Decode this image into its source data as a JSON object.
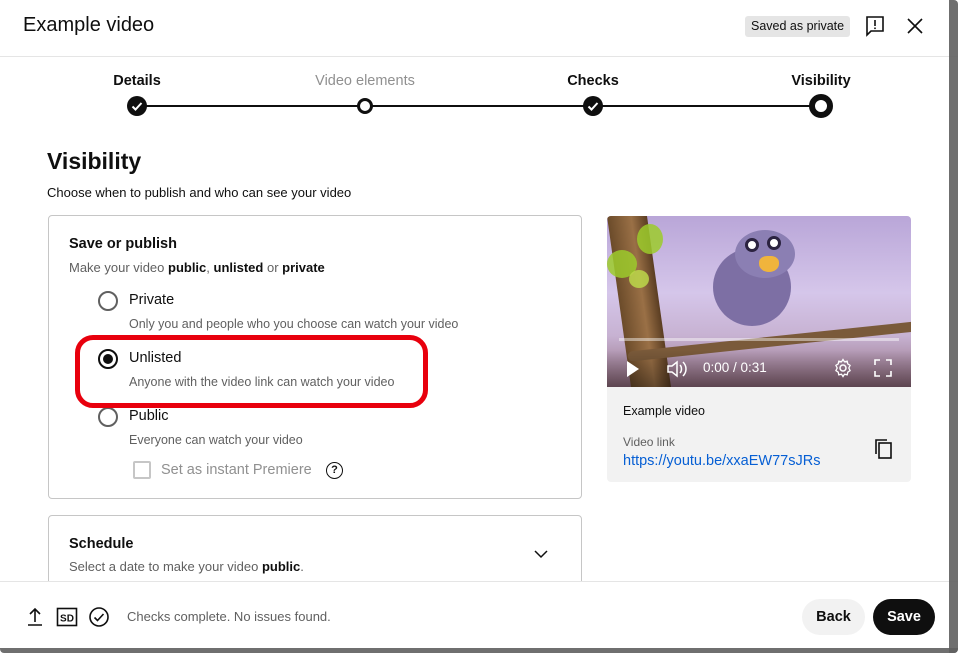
{
  "header": {
    "title": "Example video",
    "badge": "Saved as private"
  },
  "stepper": {
    "steps": [
      {
        "label": "Details",
        "state": "done"
      },
      {
        "label": "Video elements",
        "state": "pending"
      },
      {
        "label": "Checks",
        "state": "done"
      },
      {
        "label": "Visibility",
        "state": "current"
      }
    ]
  },
  "visibility": {
    "heading": "Visibility",
    "subheading": "Choose when to publish and who can see your video",
    "save_publish": {
      "title": "Save or publish",
      "sub_prefix": "Make your video ",
      "sub_public": "public",
      "sub_sep1": ", ",
      "sub_unlisted": "unlisted",
      "sub_or": " or ",
      "sub_private": "private",
      "options": [
        {
          "label": "Private",
          "desc": "Only you and people who you choose can watch your video",
          "selected": false
        },
        {
          "label": "Unlisted",
          "desc": "Anyone with the video link can watch your video",
          "selected": true
        },
        {
          "label": "Public",
          "desc": "Everyone can watch your video",
          "selected": false
        }
      ],
      "premiere_label": "Set as instant Premiere",
      "premiere_help": "?"
    },
    "schedule": {
      "title": "Schedule",
      "sub_prefix": "Select a date to make your video ",
      "sub_bold": "public",
      "sub_suffix": "."
    }
  },
  "preview": {
    "time": "0:00 / 0:31",
    "video_title": "Example video",
    "link_label": "Video link",
    "link": "https://youtu.be/xxaEW77sJRs"
  },
  "footer": {
    "status": "Checks complete. No issues found.",
    "sd_label": "SD",
    "back_label": "Back",
    "save_label": "Save"
  },
  "colors": {
    "highlight": "#e8000d",
    "link": "#065fd4",
    "primary": "#0f0f0f"
  }
}
